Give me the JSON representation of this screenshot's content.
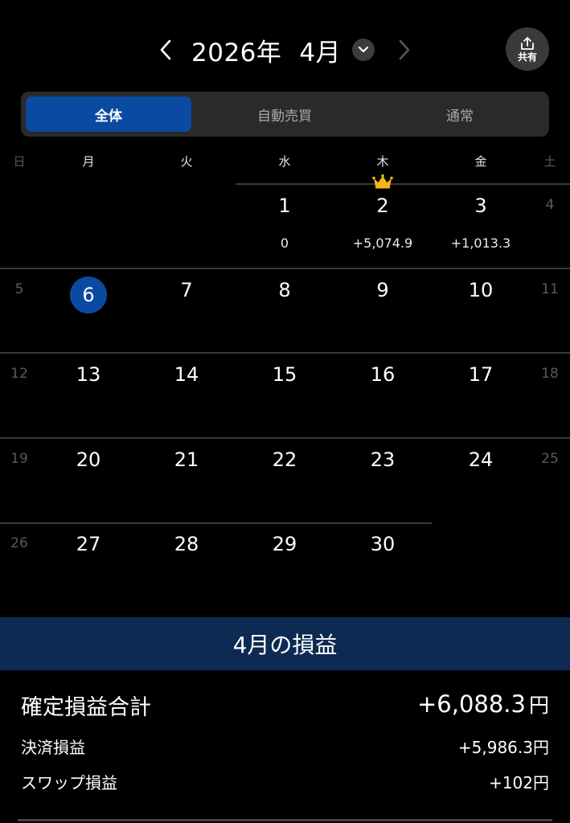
{
  "header": {
    "year_label": "2026年",
    "month_label": "4月",
    "share_label": "共有"
  },
  "tabs": [
    {
      "label": "全体",
      "active": true
    },
    {
      "label": "自動売買",
      "active": false
    },
    {
      "label": "通常",
      "active": false
    }
  ],
  "weekdays": [
    "日",
    "月",
    "火",
    "水",
    "木",
    "金",
    "土"
  ],
  "weeks": [
    [
      "",
      "",
      "",
      "1",
      "2",
      "3",
      "4"
    ],
    [
      "5",
      "6",
      "7",
      "8",
      "9",
      "10",
      "11"
    ],
    [
      "12",
      "13",
      "14",
      "15",
      "16",
      "17",
      "18"
    ],
    [
      "19",
      "20",
      "21",
      "22",
      "23",
      "24",
      "25"
    ],
    [
      "26",
      "27",
      "28",
      "29",
      "30",
      "",
      ""
    ]
  ],
  "today": "6",
  "daily_pl": {
    "1": "0",
    "2": "+5,074.9",
    "3": "+1,013.3"
  },
  "best_day": "2",
  "summary": {
    "title": "4月の損益",
    "total_label": "確定損益合計",
    "total_value": "+6,088.3",
    "currency": "円",
    "settlement_label": "決済損益",
    "settlement_value": "+5,986.3円",
    "swap_label": "スワップ損益",
    "swap_value": "+102円"
  },
  "colors": {
    "accent": "#0a4aa3",
    "banner": "#0c2a52",
    "crown": "#f2b51a"
  }
}
